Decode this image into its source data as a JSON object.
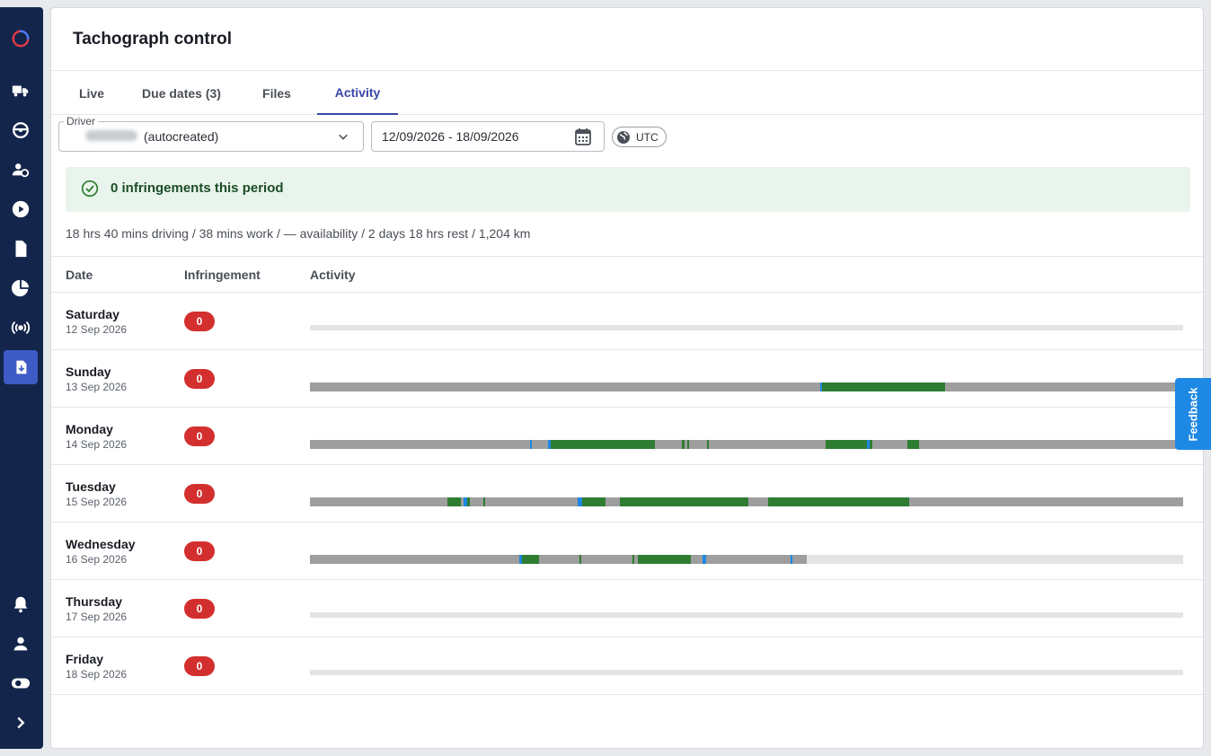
{
  "app": {
    "title": "Tachograph control"
  },
  "sidebar": {
    "items": [
      {
        "name": "logo-icon"
      },
      {
        "name": "vehicles-icon"
      },
      {
        "name": "steering-wheel-icon"
      },
      {
        "name": "driver-settings-icon"
      },
      {
        "name": "play-icon"
      },
      {
        "name": "document-icon"
      },
      {
        "name": "pie-chart-icon"
      },
      {
        "name": "broadcast-icon"
      },
      {
        "name": "tachograph-download-icon",
        "active": true
      },
      {
        "name": "bell-icon"
      },
      {
        "name": "user-icon"
      },
      {
        "name": "settings-toggle-icon"
      },
      {
        "name": "expand-chevron-icon"
      }
    ]
  },
  "tabs": [
    {
      "label": "Live"
    },
    {
      "label": "Due dates (3)"
    },
    {
      "label": "Files"
    },
    {
      "label": "Activity",
      "active": true
    }
  ],
  "filters": {
    "driver_label": "Driver",
    "driver_value": "(autocreated)",
    "date_range": "12/09/2026 - 18/09/2026",
    "timezone": "UTC"
  },
  "banner": {
    "text": "0 infringements this period"
  },
  "summary": "18 hrs 40 mins driving / 38 mins work / — availability / 2 days 18 hrs rest / 1,204 km",
  "table": {
    "headers": {
      "date": "Date",
      "infringement": "Infringement",
      "activity": "Activity"
    },
    "rows": [
      {
        "day": "Saturday",
        "date": "12 Sep 2026",
        "infringements": "0",
        "segments": []
      },
      {
        "day": "Sunday",
        "date": "13 Sep 2026",
        "infringements": "0",
        "segments": [
          [
            0,
            58.4,
            "rest"
          ],
          [
            58.4,
            58.6,
            "work"
          ],
          [
            58.6,
            72.7,
            "driving"
          ],
          [
            72.7,
            100,
            "rest"
          ]
        ]
      },
      {
        "day": "Monday",
        "date": "14 Sep 2026",
        "infringements": "0",
        "segments": [
          [
            0,
            25.2,
            "rest"
          ],
          [
            25.2,
            25.4,
            "work"
          ],
          [
            25.4,
            27.3,
            "rest"
          ],
          [
            27.3,
            27.6,
            "work"
          ],
          [
            27.6,
            39.5,
            "driving"
          ],
          [
            39.5,
            42.6,
            "rest"
          ],
          [
            42.6,
            42.9,
            "driving"
          ],
          [
            42.9,
            43.2,
            "rest"
          ],
          [
            43.2,
            43.4,
            "driving"
          ],
          [
            43.4,
            45.5,
            "rest"
          ],
          [
            45.5,
            45.7,
            "driving"
          ],
          [
            45.7,
            59.1,
            "rest"
          ],
          [
            59.1,
            63.8,
            "driving"
          ],
          [
            63.8,
            64.1,
            "work"
          ],
          [
            64.1,
            64.4,
            "driving"
          ],
          [
            64.4,
            68.4,
            "rest"
          ],
          [
            68.4,
            69.8,
            "driving"
          ],
          [
            69.8,
            100,
            "rest"
          ]
        ]
      },
      {
        "day": "Tuesday",
        "date": "15 Sep 2026",
        "infringements": "0",
        "segments": [
          [
            0,
            15.7,
            "rest"
          ],
          [
            15.7,
            17.3,
            "driving"
          ],
          [
            17.3,
            17.6,
            "rest"
          ],
          [
            17.6,
            18.0,
            "work"
          ],
          [
            18.0,
            18.3,
            "driving"
          ],
          [
            18.3,
            19.9,
            "rest"
          ],
          [
            19.9,
            20.1,
            "driving"
          ],
          [
            20.1,
            30.7,
            "rest"
          ],
          [
            30.7,
            31.2,
            "work"
          ],
          [
            31.2,
            33.8,
            "driving"
          ],
          [
            33.8,
            35.5,
            "rest"
          ],
          [
            35.5,
            50.2,
            "driving"
          ],
          [
            50.2,
            52.5,
            "rest"
          ],
          [
            52.5,
            68.6,
            "driving"
          ],
          [
            68.6,
            100,
            "rest"
          ]
        ]
      },
      {
        "day": "Wednesday",
        "date": "16 Sep 2026",
        "infringements": "0",
        "segments": [
          [
            0,
            24.0,
            "rest"
          ],
          [
            24.0,
            24.3,
            "work"
          ],
          [
            24.3,
            26.2,
            "driving"
          ],
          [
            26.2,
            30.9,
            "rest"
          ],
          [
            30.9,
            31.1,
            "driving"
          ],
          [
            31.1,
            36.9,
            "rest"
          ],
          [
            36.9,
            37.1,
            "driving"
          ],
          [
            37.1,
            37.6,
            "rest"
          ],
          [
            37.6,
            43.6,
            "driving"
          ],
          [
            43.6,
            45.0,
            "rest"
          ],
          [
            45.0,
            45.4,
            "work"
          ],
          [
            45.4,
            55.0,
            "rest"
          ],
          [
            55.0,
            55.2,
            "work"
          ],
          [
            55.2,
            56.9,
            "rest"
          ]
        ]
      },
      {
        "day": "Thursday",
        "date": "17 Sep 2026",
        "infringements": "0",
        "segments": []
      },
      {
        "day": "Friday",
        "date": "18 Sep 2026",
        "infringements": "0",
        "segments": []
      }
    ]
  },
  "colors": {
    "driving": "#2e7d32",
    "rest": "#9e9e9e",
    "work": "#1e88e5",
    "empty": "#e3e4e6",
    "accent": "#3847a8",
    "badge": "#d32f2f"
  },
  "feedback": {
    "label": "Feedback"
  }
}
